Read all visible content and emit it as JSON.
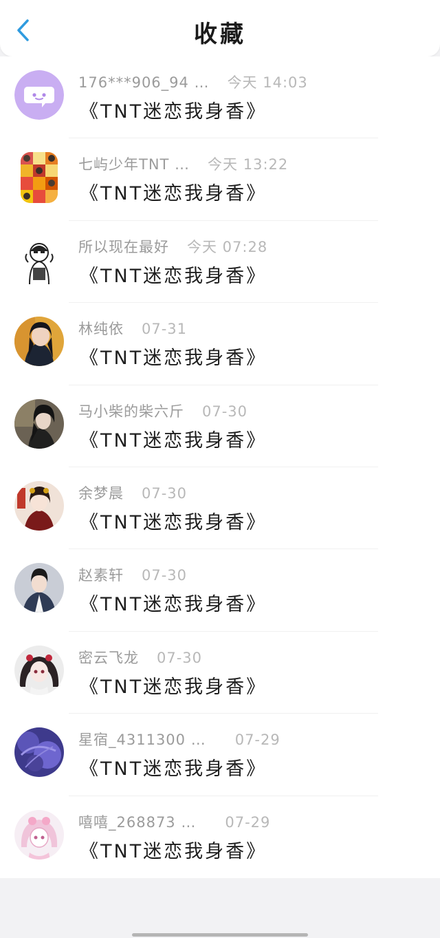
{
  "header": {
    "title": "收藏"
  },
  "items": [
    {
      "user": "176***906_94 …",
      "time": "今天 14:03",
      "song": "《TNT迷恋我身香》",
      "avatar": "wechat-style-avatar"
    },
    {
      "user": "七屿少年TNT …",
      "time": "今天 13:22",
      "song": "《TNT迷恋我身香》",
      "avatar": "collage-avatar"
    },
    {
      "user": "所以现在最好",
      "time": "今天 07:28",
      "song": "《TNT迷恋我身香》",
      "avatar": "sketch-girl-avatar"
    },
    {
      "user": "林纯依",
      "time": "07-31",
      "song": "《TNT迷恋我身香》",
      "avatar": "photo-avatar"
    },
    {
      "user": "马小柴的柴六斤",
      "time": "07-30",
      "song": "《TNT迷恋我身香》",
      "avatar": "photo-avatar"
    },
    {
      "user": "余梦晨",
      "time": "07-30",
      "song": "《TNT迷恋我身香》",
      "avatar": "photo-avatar"
    },
    {
      "user": "赵素轩",
      "time": "07-30",
      "song": "《TNT迷恋我身香》",
      "avatar": "photo-avatar"
    },
    {
      "user": "密云飞龙",
      "time": "07-30",
      "song": "《TNT迷恋我身香》",
      "avatar": "anime-avatar"
    },
    {
      "user": "星宿_4311300 …",
      "time": "07-29",
      "song": "《TNT迷恋我身香》",
      "avatar": "purple-avatar"
    },
    {
      "user": "嘻嘻_268873 …",
      "time": "07-29",
      "song": "《TNT迷恋我身香》",
      "avatar": "anime-avatar"
    }
  ],
  "colors": {
    "back_arrow": "#2f9bdf",
    "avatar_purple": "#c9aef2"
  }
}
